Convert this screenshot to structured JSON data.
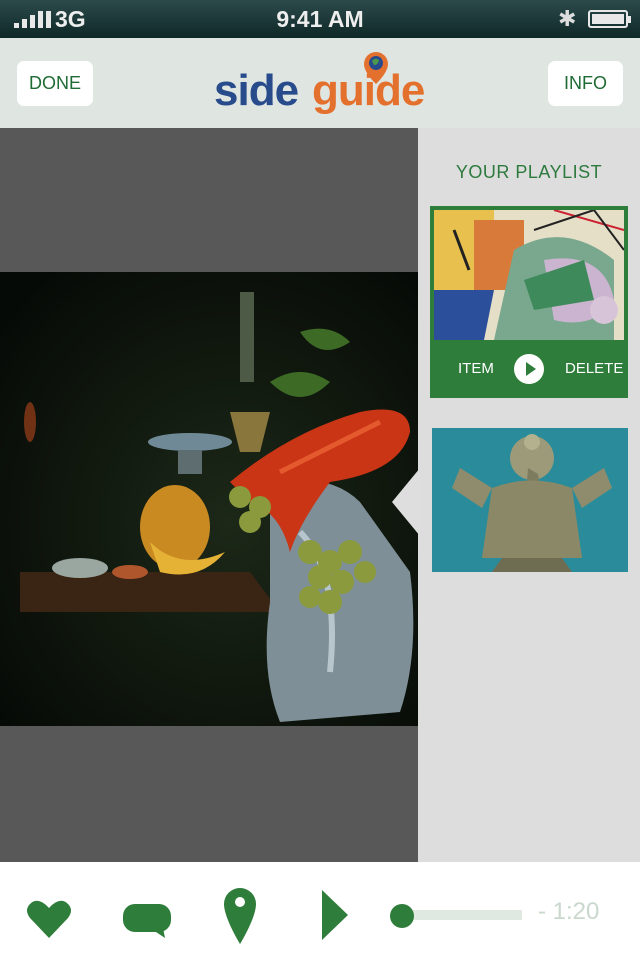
{
  "status_bar": {
    "carrier": "3G",
    "time": "9:41 AM"
  },
  "nav": {
    "done_label": "DONE",
    "info_label": "INFO",
    "logo_text_left": "side",
    "logo_text_right": "guide"
  },
  "playlist": {
    "title": "YOUR PLAYLIST",
    "item_label": "ITEM",
    "delete_label": "DELETE"
  },
  "player": {
    "time_remaining": "- 1:20",
    "progress": 0.0
  },
  "icons": {
    "favorite": "heart-icon",
    "comment": "speech-bubble-icon",
    "location": "map-pin-icon",
    "play": "play-icon"
  },
  "colors": {
    "brand_green": "#2f7d3b",
    "logo_blue": "#284b8c",
    "logo_orange": "#e4702e"
  }
}
